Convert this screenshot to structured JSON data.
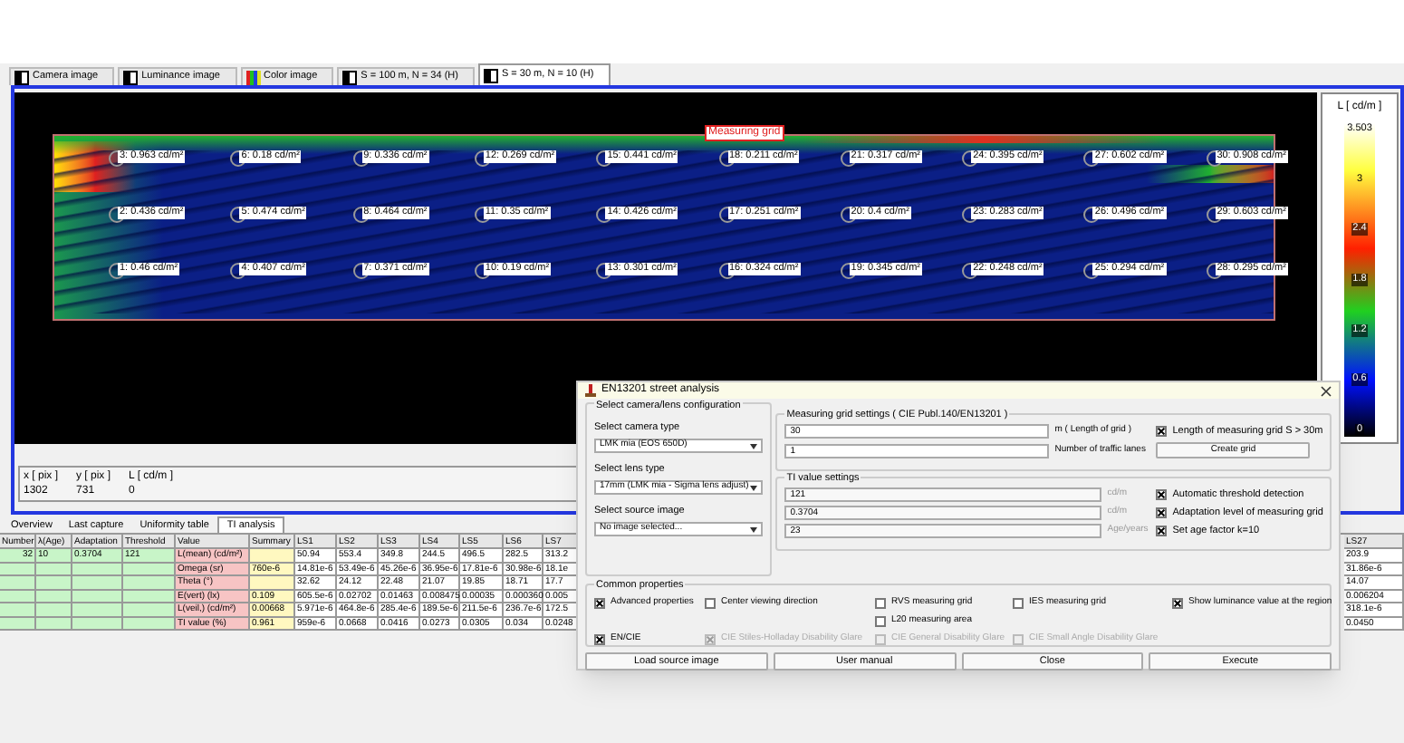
{
  "tabs": [
    {
      "label": "Camera image",
      "selected": false,
      "kind": "mono"
    },
    {
      "label": "Luminance image",
      "selected": false,
      "kind": "mono"
    },
    {
      "label": "Color image",
      "selected": false,
      "kind": "color"
    },
    {
      "label": "S = 100 m, N = 34 (H)",
      "selected": false,
      "kind": "mono"
    },
    {
      "label": "S = 30 m, N = 10 (H)",
      "selected": true,
      "kind": "mono"
    }
  ],
  "image": {
    "grid_label": "Measuring grid",
    "grid_rows": [
      {
        "labels": [
          "3: 0.963 cd/m²",
          "6: 0.18 cd/m²",
          "9: 0.336 cd/m²",
          "12: 0.269 cd/m²",
          "15: 0.441 cd/m²",
          "18: 0.211 cd/m²",
          "21: 0.317 cd/m²",
          "24: 0.395 cd/m²",
          "27: 0.602 cd/m²",
          "30: 0.908 cd/m²"
        ]
      },
      {
        "labels": [
          "2: 0.436 cd/m²",
          "5: 0.474 cd/m²",
          "8: 0.464 cd/m²",
          "11: 0.35 cd/m²",
          "14: 0.426 cd/m²",
          "17: 0.251 cd/m²",
          "20: 0.4 cd/m²",
          "23: 0.283 cd/m²",
          "26: 0.496 cd/m²",
          "29: 0.603 cd/m²"
        ]
      },
      {
        "labels": [
          "1: 0.46 cd/m²",
          "4: 0.407 cd/m²",
          "7: 0.371 cd/m²",
          "10: 0.19 cd/m²",
          "13: 0.301 cd/m²",
          "16: 0.324 cd/m²",
          "19: 0.345 cd/m²",
          "22: 0.248 cd/m²",
          "25: 0.294 cd/m²",
          "28: 0.295 cd/m²"
        ]
      }
    ]
  },
  "colorbar": {
    "title": "L [ cd/m ]",
    "ticks": [
      "3.503",
      "3",
      "2.4",
      "1.8",
      "1.2",
      "0.6",
      "0"
    ]
  },
  "readout": [
    {
      "header": "x [ pix ]",
      "value": "1302"
    },
    {
      "header": "y [ pix ]",
      "value": "731"
    },
    {
      "header": "L [ cd/m ]",
      "value": "0"
    }
  ],
  "bottom_tabs": [
    {
      "label": "Overview",
      "selected": false
    },
    {
      "label": "Last capture",
      "selected": false
    },
    {
      "label": "Uniformity table",
      "selected": false
    },
    {
      "label": "TI analysis",
      "selected": true
    }
  ],
  "table": {
    "columns": [
      {
        "header": "Number",
        "kind": "input",
        "cells": [
          "32",
          null,
          null,
          null,
          null,
          null
        ]
      },
      {
        "header": "λ(Age)",
        "kind": "input",
        "cells": [
          "10",
          null,
          null,
          null,
          null,
          null
        ]
      },
      {
        "header": "Adaptation",
        "kind": "input",
        "cells": [
          "0.3704",
          null,
          null,
          null,
          null,
          null
        ]
      },
      {
        "header": "Threshold",
        "kind": "input",
        "cells": [
          "121",
          null,
          null,
          null,
          null,
          null
        ]
      },
      {
        "header": "Value",
        "kind": "value",
        "cells": [
          "L(mean) (cd/m²)",
          "Omega (sr)",
          "Theta (°)",
          "E(vert) (lx)",
          "L(veil,) (cd/m²)",
          "TI value (%)"
        ]
      },
      {
        "header": "Summary",
        "kind": "summary",
        "cells": [
          null,
          "760e-6",
          null,
          "0.109",
          "0.00668",
          "0.961"
        ]
      },
      {
        "header": "LS1",
        "kind": "ls",
        "cells": [
          "50.94",
          "14.81e-6",
          "32.62",
          "605.5e-6",
          "5.971e-6",
          "959e-6"
        ]
      },
      {
        "header": "LS2",
        "kind": "ls",
        "cells": [
          "553.4",
          "53.49e-6",
          "24.12",
          "0.02702",
          "464.8e-6",
          "0.0668"
        ]
      },
      {
        "header": "LS3",
        "kind": "ls",
        "cells": [
          "349.8",
          "45.26e-6",
          "22.48",
          "0.01463",
          "285.4e-6",
          "0.0416"
        ]
      },
      {
        "header": "LS4",
        "kind": "ls",
        "cells": [
          "244.5",
          "36.95e-6",
          "21.07",
          "0.008475",
          "189.5e-6",
          "0.0273"
        ]
      },
      {
        "header": "LS5",
        "kind": "ls",
        "cells": [
          "496.5",
          "17.81e-6",
          "19.85",
          "0.00035",
          "211.5e-6",
          "0.0305"
        ]
      },
      {
        "header": "LS6",
        "kind": "ls",
        "cells": [
          "282.5",
          "30.98e-6",
          "18.71",
          "0.000360",
          "236.7e-6",
          "0.034"
        ]
      },
      {
        "header": "LS7",
        "kind": "ls",
        "cells": [
          "313.2",
          "18.1e",
          "17.7",
          "0.005",
          "172.5",
          "0.0248"
        ]
      },
      {
        "header": "LS27",
        "kind": "ls",
        "cells": [
          "203.9",
          "31.86e-6",
          "14.07",
          "0.006204",
          "318.1e-6",
          "0.0450"
        ]
      }
    ]
  },
  "dialog": {
    "title": "EN13201 street analysis",
    "camera_group": {
      "title": "Select camera/lens configuration",
      "fields": [
        {
          "label": "Select camera type",
          "value": "LMK mia (EOS 650D)"
        },
        {
          "label": "Select lens type",
          "value": "17mm (LMK mia - Sigma lens adjust)"
        },
        {
          "label": "Select source image",
          "value": "No image selected..."
        }
      ]
    },
    "grid_group": {
      "title": "Measuring grid settings ( CIE Publ.140/EN13201 )",
      "rows": [
        {
          "value": "30",
          "unit": "m ( Length of grid )",
          "kind": "checkbox",
          "option": {
            "label": "Length of measuring grid S > 30m",
            "checked": true
          }
        },
        {
          "value": "1",
          "unit": "Number of traffic lanes",
          "kind": "button",
          "button": "Create grid"
        }
      ]
    },
    "ti_group": {
      "title": "TI value settings",
      "rows": [
        {
          "value": "121",
          "unit": "cd/m",
          "option": {
            "label": "Automatic threshold detection",
            "checked": true
          }
        },
        {
          "value": "0.3704",
          "unit": "cd/m",
          "option": {
            "label": "Adaptation level of measuring grid",
            "checked": true
          }
        },
        {
          "value": "23",
          "unit": "Age/years",
          "option": {
            "label": "Set age factor k=10",
            "checked": true
          }
        }
      ]
    },
    "common": {
      "title": "Common properties",
      "rows": [
        [
          {
            "label": "Advanced properties",
            "checked": true,
            "disabled": false
          },
          {
            "label": "Center viewing direction",
            "checked": false,
            "disabled": false
          },
          {
            "label": "RVS measuring grid",
            "checked": false,
            "disabled": false
          },
          {
            "label": "IES measuring grid",
            "checked": false,
            "disabled": false
          },
          {
            "label": "Show luminance value at the region",
            "checked": true,
            "disabled": false
          }
        ],
        [
          null,
          null,
          {
            "label": "L20 measuring area",
            "checked": false,
            "disabled": false
          },
          null,
          null
        ],
        [
          {
            "label": "EN/CIE",
            "checked": true,
            "disabled": false
          },
          {
            "label": "CIE Stiles-Holladay Disability Glare",
            "checked": true,
            "disabled": true
          },
          {
            "label": "CIE General Disability Glare",
            "checked": false,
            "disabled": true
          },
          {
            "label": "CIE Small Angle Disability Glare",
            "checked": false,
            "disabled": true
          },
          null
        ]
      ]
    },
    "buttons": [
      "Load source image",
      "User manual",
      "Close",
      "Execute"
    ]
  }
}
